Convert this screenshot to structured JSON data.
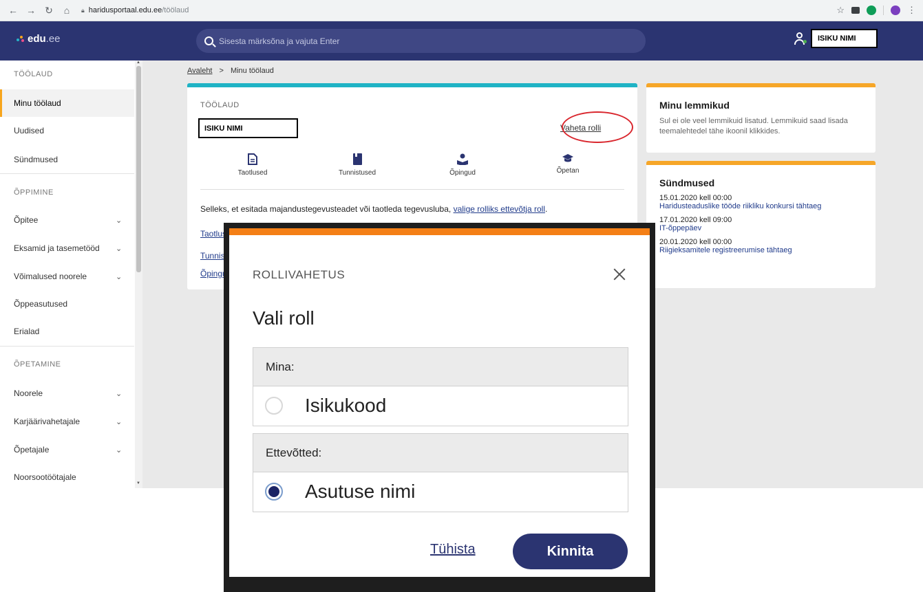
{
  "browser": {
    "url_host": "haridusportaal.edu.ee",
    "url_path": "/töölaud",
    "ext_colors": [
      "#5f6368",
      "#16a34a",
      "#0f9d58",
      "#7b3fbf"
    ]
  },
  "header": {
    "logo_brand": "edu",
    "logo_domain": ".ee",
    "search_placeholder": "Sisesta märksõna ja vajuta Enter",
    "user_name": "ISIKU NIMI",
    "accent_color": "#2b3471"
  },
  "sidebar": {
    "section_toolaud": "TÖÖLAUD",
    "item_minu_toolaud": "Minu töölaud",
    "item_uudised": "Uudised",
    "item_syndmused": "Sündmused",
    "section_oppimine": "ÕPPIMINE",
    "item_opitee": "Õpitee",
    "item_eksamid": "Eksamid ja tasemetööd",
    "item_voimalused": "Võimalused noorele",
    "item_oppeasutused": "Õppeasutused",
    "item_erialad": "Erialad",
    "section_opetamine": "ÕPETAMINE",
    "item_noorele": "Noorele",
    "item_karjaar": "Karjäärivahetajale",
    "item_opetajale": "Õpetajale",
    "item_noorsootootajale": "Noorsootöötajale"
  },
  "breadcrumb": {
    "home": "Avaleht",
    "separator": ">",
    "current": "Minu töölaud"
  },
  "toolaud": {
    "label": "TÖÖLAUD",
    "name": "ISIKU NIMI",
    "change_role": "Vaheta rolli",
    "quick_links": [
      "Taotlused",
      "Tunnistused",
      "Õpingud",
      "Õpetan"
    ],
    "info_text": "Selleks, et esitada majandustegevusteadet või taotleda tegevusluba,",
    "info_link": "valige rolliks ettevõtja roll",
    "info_end": ".",
    "link_1": "Taotlused",
    "link_2": "Tunnistused",
    "link_3": "Õpingud"
  },
  "lemmikud": {
    "title": "Minu lemmikud",
    "text": "Sul ei ole veel lemmikuid lisatud. Lemmikuid saad lisada teemalehtedel tähe ikoonil klikkides."
  },
  "syndmused": {
    "title": "Sündmused",
    "events": [
      {
        "date": "15.01.2020 kell 00:00",
        "title": "Haridusteaduslike tööde riikliku konkursi tähtaeg"
      },
      {
        "date": "17.01.2020 kell 09:00",
        "title": "IT-õppepäev"
      },
      {
        "date": "20.01.2020 kell 00:00",
        "title": "Riigieksamitele registreerumise tähtaeg"
      }
    ]
  },
  "modal": {
    "label": "ROLLIVAHETUS",
    "title": "Vali roll",
    "group1_header": "Mina:",
    "group1_option": "Isikukood",
    "group2_header": "Ettevõtted:",
    "group2_option": "Asutuse nimi",
    "cancel": "Tühista",
    "confirm": "Kinnita",
    "accent_color": "#f47f16"
  }
}
